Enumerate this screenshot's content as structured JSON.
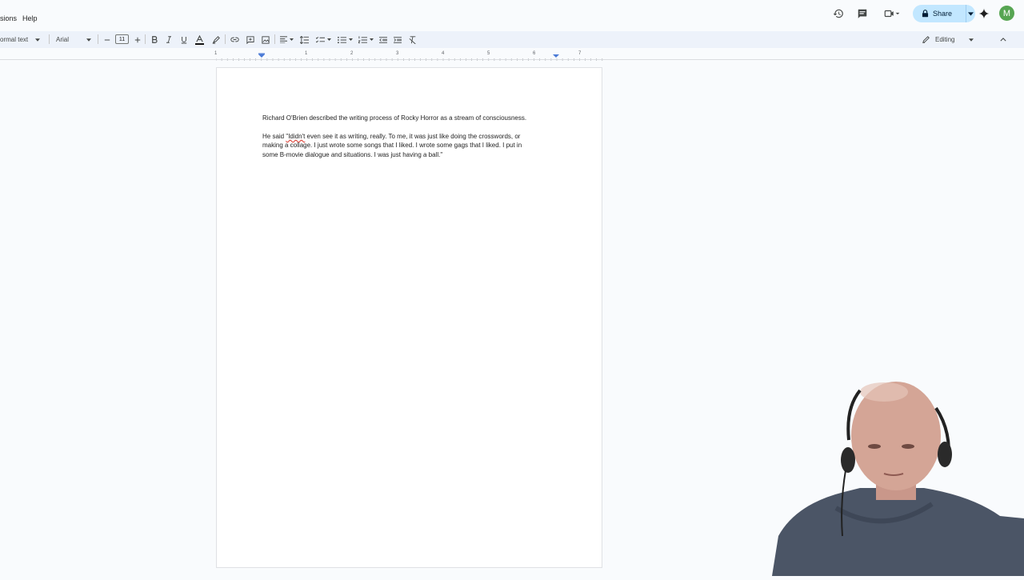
{
  "menu": {
    "extensions": "sions",
    "help": "Help"
  },
  "topbar": {
    "share_label": "Share",
    "avatar_initial": "M",
    "brand_color": "#56a552",
    "share_bg": "#c2e7ff"
  },
  "toolbar": {
    "style": "ormal text",
    "font": "Arial",
    "font_size": "11",
    "mode": "Editing",
    "icons": [
      "minus-icon",
      "plus-icon",
      "bold-icon",
      "italic-icon",
      "underline-icon",
      "text-color-icon",
      "highlight-icon",
      "link-icon",
      "comment-icon",
      "image-icon",
      "align-icon",
      "line-spacing-icon",
      "checklist-icon",
      "bullet-list-icon",
      "numbered-list-icon",
      "decrease-indent-icon",
      "increase-indent-icon",
      "clear-format-icon"
    ]
  },
  "ruler": {
    "numbers": [
      "1",
      "1",
      "2",
      "3",
      "4",
      "5",
      "6",
      "7"
    ]
  },
  "document": {
    "para1": "Richard O'Brien described the writing process of Rocky Horror as a stream of consciousness.",
    "para2_before": "He said ",
    "para2_error": "\"Ididn't",
    "para2_line1_after": " even see it as writing, really. To me, it was just like doing the crosswords, or",
    "para2_line2": "making a collage. I just wrote some songs that I liked. I wrote some gags that I liked. I put in",
    "para2_line3": "some B-movie dialogue and situations. I was just having a ball.\""
  }
}
